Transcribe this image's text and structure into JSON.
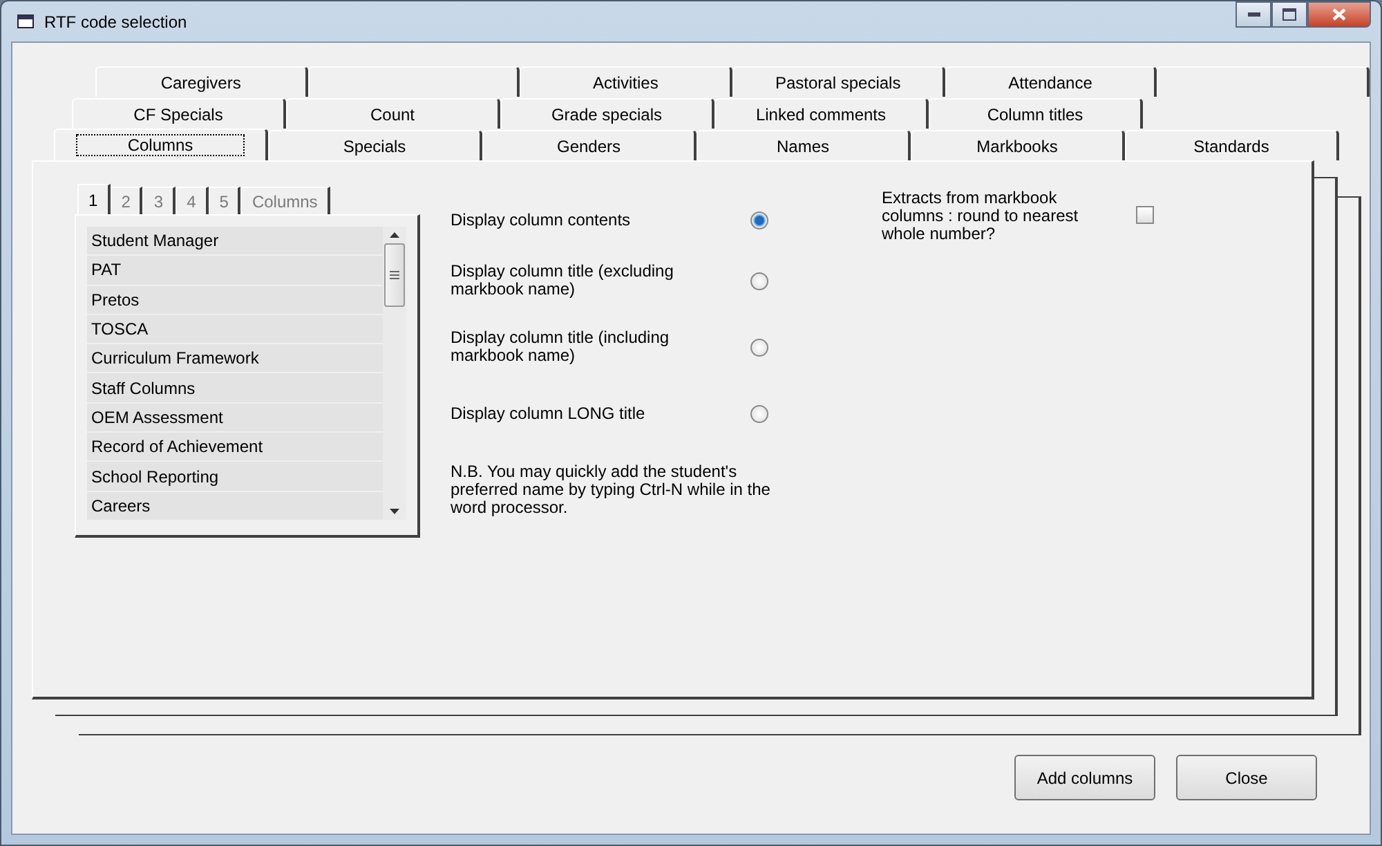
{
  "window": {
    "title": "RTF code selection"
  },
  "tab_rows": [
    [
      {
        "kind": "tab",
        "label": "Caregivers",
        "selected": false
      },
      {
        "kind": "blank",
        "selected": false
      },
      {
        "kind": "tab",
        "label": "Activities",
        "selected": false
      },
      {
        "kind": "tab",
        "label": "Pastoral specials",
        "selected": false
      },
      {
        "kind": "tab",
        "label": "Attendance",
        "selected": false
      },
      {
        "kind": "blank",
        "selected": false
      }
    ],
    [
      {
        "kind": "tab",
        "label": "CF Specials",
        "selected": false
      },
      {
        "kind": "tab",
        "label": "Count",
        "selected": false
      },
      {
        "kind": "tab",
        "label": "Grade specials",
        "selected": false
      },
      {
        "kind": "tab",
        "label": "Linked comments",
        "selected": false
      },
      {
        "kind": "tab",
        "label": "Column titles",
        "selected": false
      }
    ],
    [
      {
        "kind": "tab",
        "label": "Columns",
        "selected": true
      },
      {
        "kind": "tab",
        "label": "Specials",
        "selected": false
      },
      {
        "kind": "tab",
        "label": "Genders",
        "selected": false
      },
      {
        "kind": "tab",
        "label": "Names",
        "selected": false
      },
      {
        "kind": "tab",
        "label": "Markbooks",
        "selected": false
      },
      {
        "kind": "tab",
        "label": "Standards",
        "selected": false
      }
    ]
  ],
  "sub_tabs": [
    {
      "label": "1",
      "selected": true
    },
    {
      "label": "2",
      "selected": false
    },
    {
      "label": "3",
      "selected": false
    },
    {
      "label": "4",
      "selected": false
    },
    {
      "label": "5",
      "selected": false
    },
    {
      "label": "Columns",
      "selected": false
    }
  ],
  "list_items": [
    "Student Manager",
    "PAT",
    "Pretos",
    "TOSCA",
    "Curriculum Framework",
    "Staff Columns",
    "OEM Assessment",
    "Record of Achievement",
    "School Reporting",
    "Careers"
  ],
  "display_options": [
    {
      "label": "Display column contents",
      "selected": true
    },
    {
      "label": "Display column title (excluding markbook name)",
      "selected": false
    },
    {
      "label": "Display column title (including markbook name)",
      "selected": false
    },
    {
      "label": "Display column LONG title",
      "selected": false
    }
  ],
  "note": "N.B. You may quickly add the student's preferred name by typing Ctrl-N while in the word processor.",
  "round_option": {
    "label": "Extracts from markbook columns : round to nearest whole number?",
    "checked": false
  },
  "buttons": [
    "Add columns",
    "Close"
  ]
}
